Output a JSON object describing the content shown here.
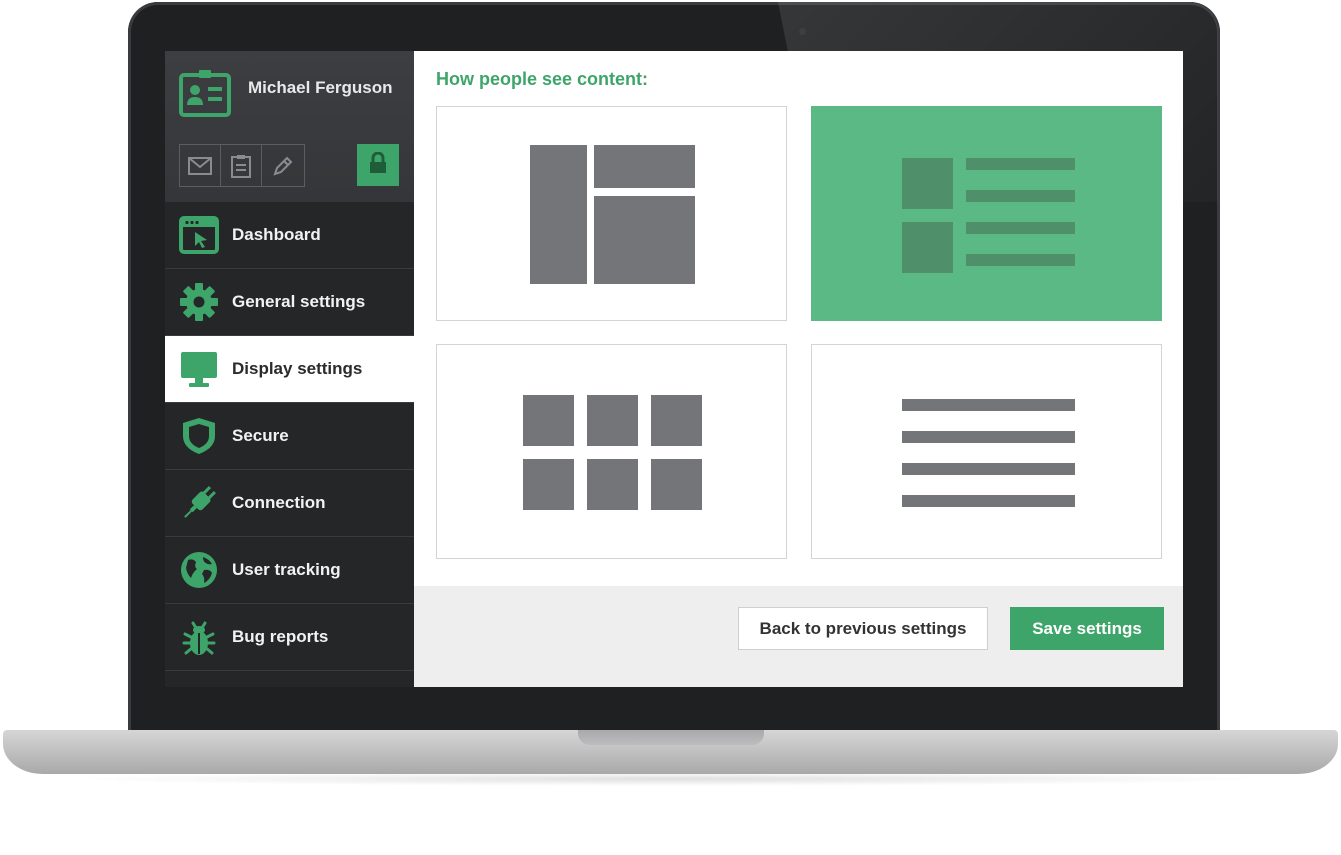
{
  "user": {
    "name": "Michael Ferguson"
  },
  "profile_tools": {
    "items": [
      {
        "icon": "envelope-icon"
      },
      {
        "icon": "clipboard-icon"
      },
      {
        "icon": "pencil-icon"
      }
    ],
    "lock_icon": "lock-icon"
  },
  "sidebar": {
    "items": [
      {
        "label": "Dashboard",
        "icon": "dashboard-window-icon",
        "active": false
      },
      {
        "label": "General settings",
        "icon": "gear-icon",
        "active": false
      },
      {
        "label": "Display settings",
        "icon": "monitor-icon",
        "active": true
      },
      {
        "label": "Secure",
        "icon": "shield-icon",
        "active": false
      },
      {
        "label": "Connection",
        "icon": "plug-icon",
        "active": false
      },
      {
        "label": "User tracking",
        "icon": "globe-icon",
        "active": false
      },
      {
        "label": "Bug reports",
        "icon": "bug-icon",
        "active": false
      }
    ]
  },
  "main": {
    "heading": "How people see content:",
    "layouts": [
      {
        "id": "mosaic",
        "selected": false
      },
      {
        "id": "list-with-thumbnails",
        "selected": true
      },
      {
        "id": "grid",
        "selected": false
      },
      {
        "id": "text-list",
        "selected": false
      }
    ]
  },
  "footer": {
    "back_label": "Back to previous settings",
    "save_label": "Save settings"
  },
  "colors": {
    "accent": "#3ea56a",
    "selected_card": "#5bb985",
    "sidebar_bg": "#252628",
    "placeholder_gray": "#737578"
  }
}
